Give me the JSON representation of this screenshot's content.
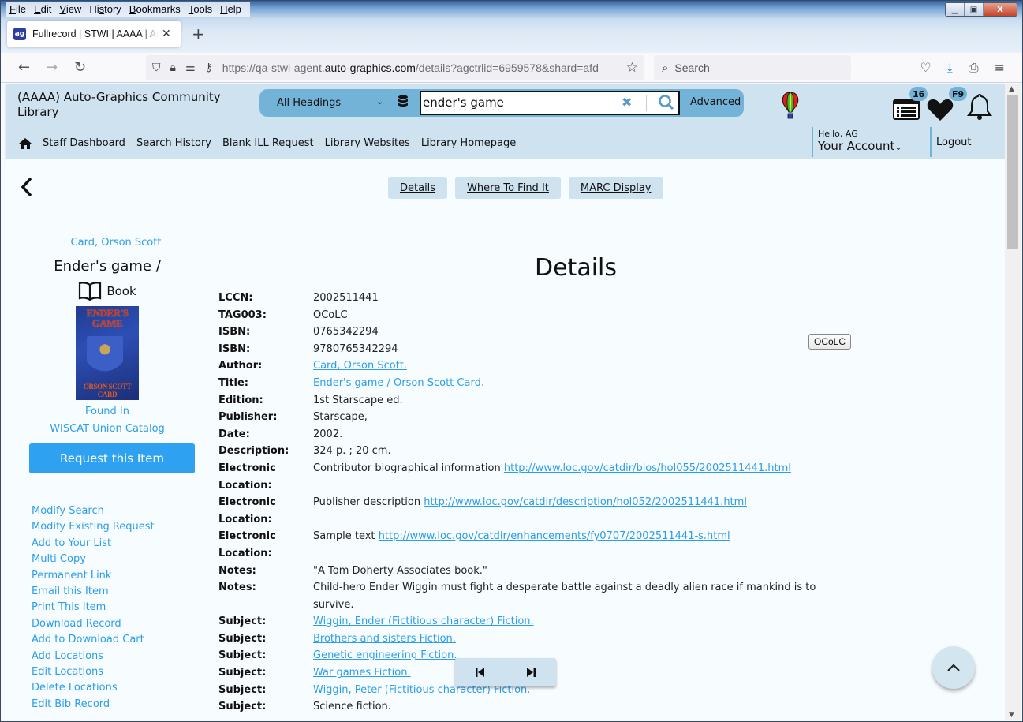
{
  "browser": {
    "menu": [
      "File",
      "Edit",
      "View",
      "History",
      "Bookmarks",
      "Tools",
      "Help"
    ],
    "tab_title": "Fullrecord | STWI | AAAA | Auto-Graphics",
    "new_tab_label": "+",
    "url_prefix": "https://qa-stwi-agent.",
    "url_domain": "auto-graphics.com",
    "url_rest": "/details?agctrlid=6959578&shard=afd",
    "search_placeholder": "Search"
  },
  "header": {
    "library_name": "(AAAA) Auto-Graphics Community Library",
    "search_scope": "All Headings",
    "search_value": "ender's game",
    "advanced_label": "Advanced",
    "list_badge": "16",
    "favorites_badge": "F9",
    "nav": [
      "Staff Dashboard",
      "Search History",
      "Blank ILL Request",
      "Library Websites",
      "Library Homepage"
    ],
    "greeting": "Hello, AG",
    "account_label": "Your Account",
    "logout_label": "Logout"
  },
  "view_tabs": [
    "Details",
    "Where To Find It",
    "MARC Display"
  ],
  "sidebar": {
    "author": "Card, Orson Scott",
    "title": "Ender's game /",
    "format": "Book",
    "cover_title": "ENDER'S GAME",
    "cover_author": "ORSON SCOTT CARD",
    "found_in_label": "Found In",
    "found_in_value": "WISCAT Union Catalog",
    "request_label": "Request this Item",
    "actions": [
      "Modify Search",
      "Modify Existing Request",
      "Add to Your List",
      "Multi Copy",
      "Permanent Link",
      "Email this Item",
      "Print This Item",
      "Download Record",
      "Add to Download Cart",
      "Add Locations",
      "Edit Locations",
      "Delete Locations",
      "Edit Bib Record"
    ]
  },
  "details": {
    "heading": "Details",
    "ocolc_button": "OCoLC",
    "rows": [
      {
        "label": "LCCN:",
        "text": "2002511441"
      },
      {
        "label": "TAG003:",
        "text": "OCoLC"
      },
      {
        "label": "ISBN:",
        "text": "0765342294"
      },
      {
        "label": "ISBN:",
        "text": "9780765342294"
      },
      {
        "label": "Author:",
        "link": "Card, Orson Scott."
      },
      {
        "label": "Title:",
        "link": "Ender's game / Orson Scott Card."
      },
      {
        "label": "Edition:",
        "text": "1st Starscape ed."
      },
      {
        "label": "Publisher:",
        "text": "Starscape,"
      },
      {
        "label": "Date:",
        "text": "2002."
      },
      {
        "label": "Description:",
        "text": "324 p. ; 20 cm."
      },
      {
        "label": "Electronic Location:",
        "text": "Contributor biographical information",
        "link": "http://www.loc.gov/catdir/bios/hol055/2002511441.html"
      },
      {
        "label": "Electronic Location:",
        "text": "Publisher description",
        "link": "http://www.loc.gov/catdir/description/hol052/2002511441.html"
      },
      {
        "label": "Electronic Location:",
        "text": "Sample text",
        "link": "http://www.loc.gov/catdir/enhancements/fy0707/2002511441-s.html"
      },
      {
        "label": "Notes:",
        "text": "\"A Tom Doherty Associates book.\""
      },
      {
        "label": "Notes:",
        "text": "Child-hero Ender Wiggin must fight a desperate battle against a deadly alien race if mankind is to survive."
      },
      {
        "label": "Subject:",
        "link": "Wiggin, Ender (Fictitious character) Fiction."
      },
      {
        "label": "Subject:",
        "link": "Brothers and sisters Fiction."
      },
      {
        "label": "Subject:",
        "link": "Genetic engineering Fiction."
      },
      {
        "label": "Subject:",
        "link": "War games Fiction."
      },
      {
        "label": "Subject:",
        "link": "Wiggin, Peter (Fictitious character) Fiction."
      },
      {
        "label": "Subject:",
        "text": "Science fiction."
      }
    ]
  },
  "colors": {
    "accent": "#2c9ee8",
    "header_bg": "#cfe2ef",
    "search_pill": "#74b3d8",
    "request_button": "#2ea2f0"
  }
}
